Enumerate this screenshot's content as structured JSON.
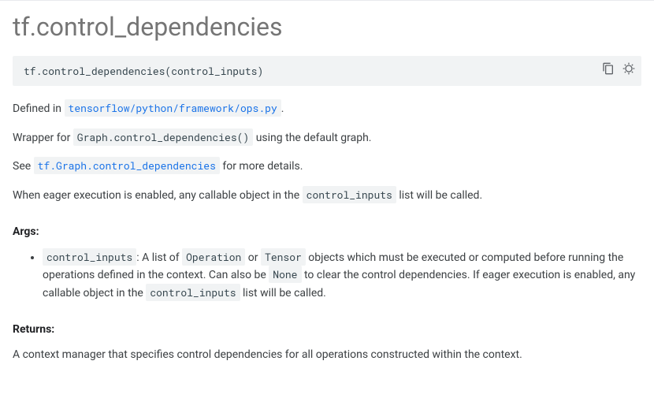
{
  "title": "tf.control_dependencies",
  "signature": "tf.control_dependencies(control_inputs)",
  "defined_in": {
    "prefix": "Defined in ",
    "link": "tensorflow/python/framework/ops.py",
    "suffix": "."
  },
  "wrapper_line": {
    "prefix": "Wrapper for ",
    "code": "Graph.control_dependencies()",
    "suffix": " using the default graph."
  },
  "see_line": {
    "prefix": "See ",
    "link": "tf.Graph.control_dependencies",
    "suffix": " for more details."
  },
  "eager_line": {
    "prefix": "When eager execution is enabled, any callable object in the ",
    "code": "control_inputs",
    "suffix": " list will be called."
  },
  "args": {
    "heading": "Args:",
    "items": [
      {
        "name": "control_inputs",
        "d1": ": A list of ",
        "c1": "Operation",
        "d2": " or ",
        "c2": "Tensor",
        "d3": " objects which must be executed or computed before running the operations defined in the context. Can also be ",
        "c3": "None",
        "d4": " to clear the control dependencies. If eager execution is enabled, any callable object in the ",
        "c4": "control_inputs",
        "d5": " list will be called."
      }
    ]
  },
  "returns": {
    "heading": "Returns:",
    "text": "A context manager that specifies control dependencies for all operations constructed within the context."
  }
}
